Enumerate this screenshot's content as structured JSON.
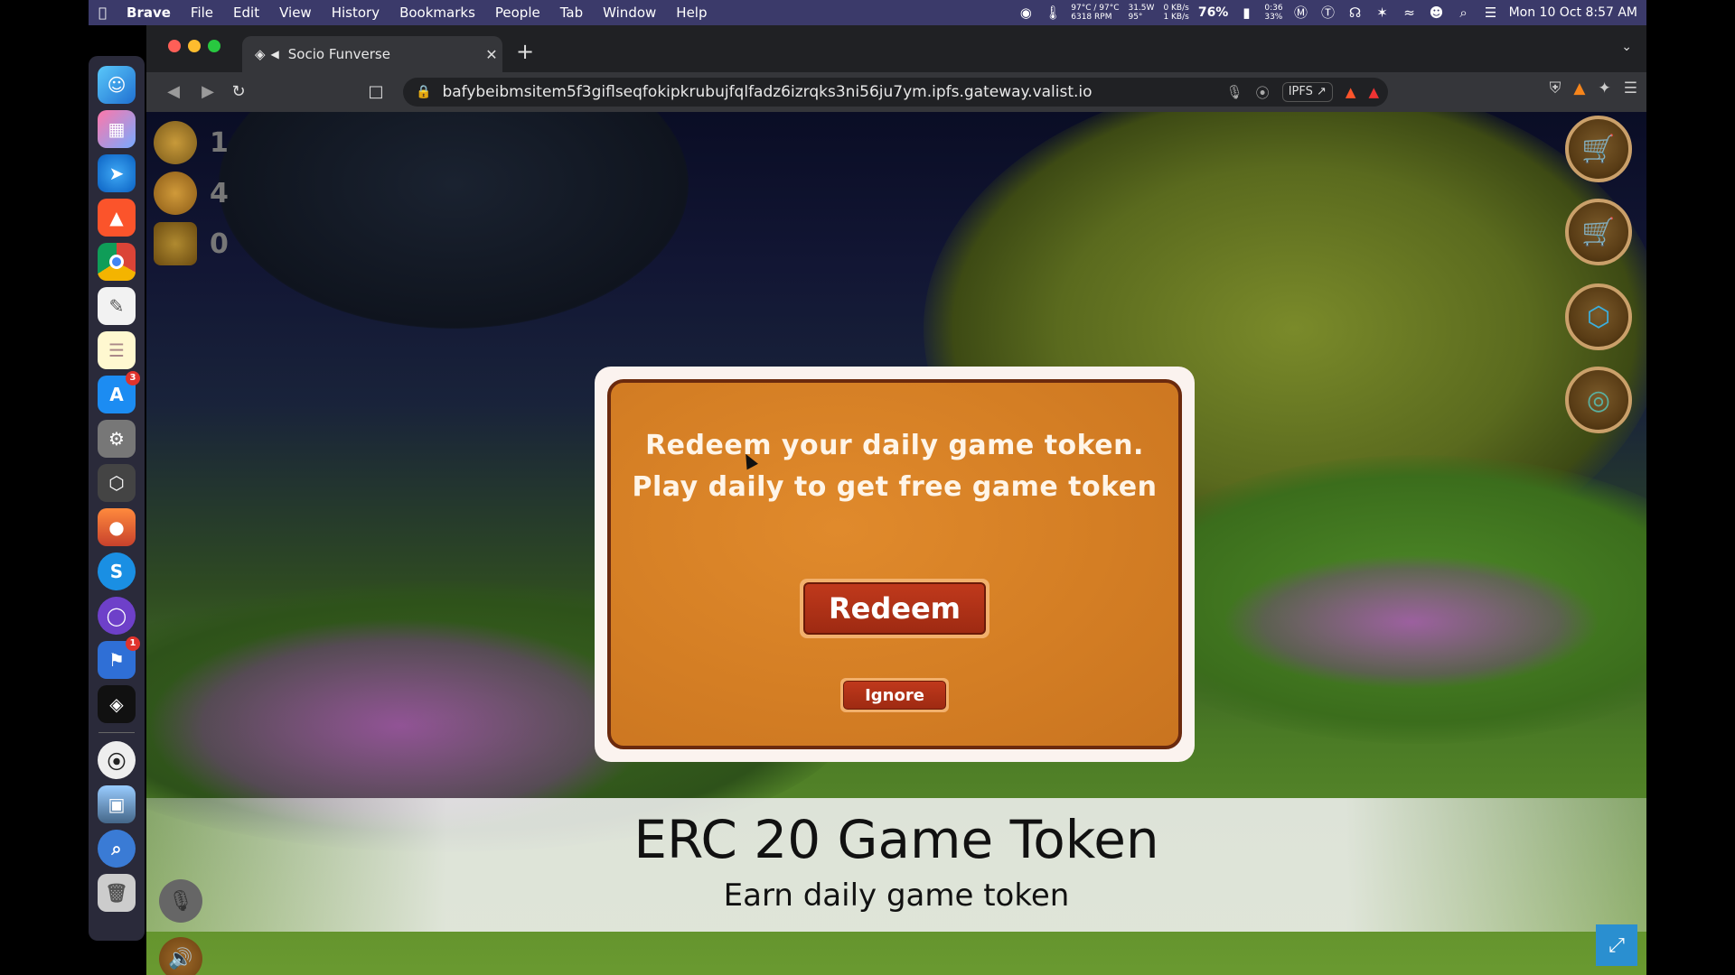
{
  "menubar": {
    "app": "Brave",
    "items": [
      "File",
      "Edit",
      "View",
      "History",
      "Bookmarks",
      "People",
      "Tab",
      "Window",
      "Help"
    ],
    "temp": "97°C / 97°C",
    "rpm": "6318 RPM",
    "power": "31.5W",
    "power_temp": "95°",
    "net_up": "0 KB/s",
    "net_down": "1 KB/s",
    "battery": "76%",
    "battery_time": "0:36",
    "battery_pct": "33%",
    "clock": "Mon 10 Oct  8:57 AM"
  },
  "dock": {
    "badges": {
      "appstore": "3",
      "feedback": "1"
    }
  },
  "browser": {
    "tab_title": "Socio Funverse",
    "url": "bafybeibmsitem5f3giflseqfokipkrubujfqlfadz6izrqks3ni56ju7ym.ipfs.gateway.valist.io",
    "ipfs_label": "IPFS"
  },
  "hud": {
    "medals": "1",
    "coins": "4",
    "trophies": "0"
  },
  "dialog": {
    "line1": "Redeem your daily game token.",
    "line2": "Play daily to get free game token",
    "redeem_label": "Redeem",
    "ignore_label": "Ignore"
  },
  "caption": {
    "title": "ERC 20 Game Token",
    "subtitle": "Earn daily game token"
  },
  "colors": {
    "dialog_panel": "#d47e24",
    "button_red": "#b0321a",
    "menubar_bg": "#3b3a6a"
  }
}
